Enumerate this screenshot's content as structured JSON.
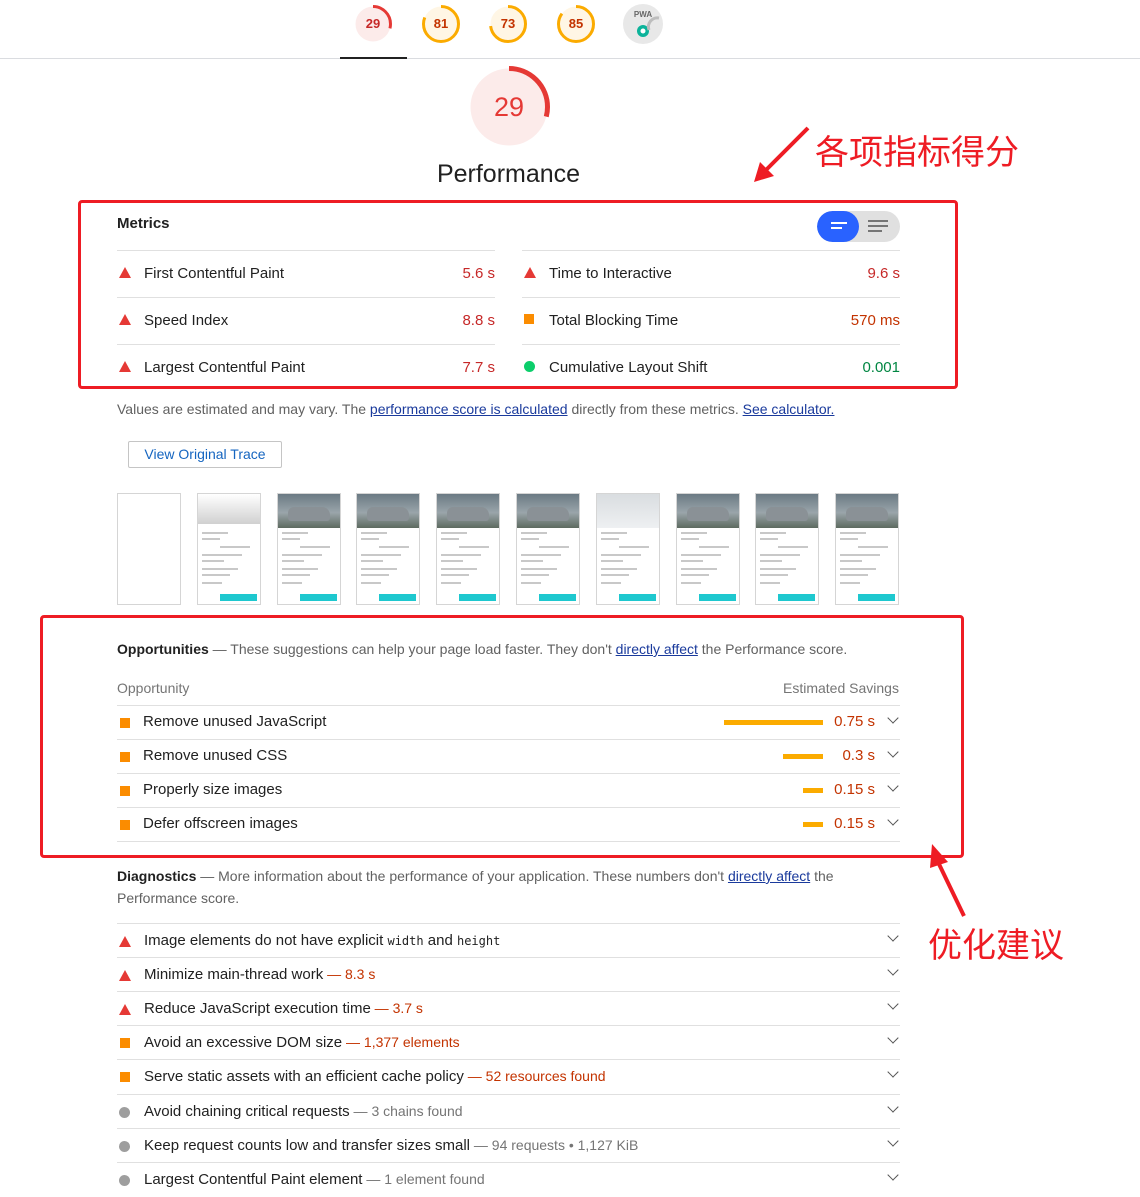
{
  "top_gauges": [
    {
      "label": "29",
      "color": "#e53935",
      "fill": 0.29
    },
    {
      "label": "81",
      "color": "#fbab00",
      "fill": 0.81
    },
    {
      "label": "73",
      "color": "#fbab00",
      "fill": 0.73
    },
    {
      "label": "85",
      "color": "#fbab00",
      "fill": 0.85
    }
  ],
  "pwa_badge": {
    "label": "PWA"
  },
  "performance": {
    "score": "29",
    "score_fraction": 0.29,
    "title": "Performance",
    "color": "#e53935"
  },
  "annotations": {
    "scores_label": "各项指标得分",
    "suggestions_label": "优化建议",
    "color": "#ee1c24"
  },
  "metrics": {
    "heading": "Metrics",
    "left": [
      {
        "label": "First Contentful Paint",
        "value": "5.6 s",
        "status": "fail"
      },
      {
        "label": "Speed Index",
        "value": "8.8 s",
        "status": "fail"
      },
      {
        "label": "Largest Contentful Paint",
        "value": "7.7 s",
        "status": "fail"
      }
    ],
    "right": [
      {
        "label": "Time to Interactive",
        "value": "9.6 s",
        "status": "fail"
      },
      {
        "label": "Total Blocking Time",
        "value": "570 ms",
        "status": "average"
      },
      {
        "label": "Cumulative Layout Shift",
        "value": "0.001",
        "status": "pass"
      }
    ]
  },
  "note": {
    "prefix": "Values are estimated and may vary. The ",
    "link1": "performance score is calculated",
    "middle": " directly from these metrics.",
    "link2": "See calculator."
  },
  "trace_button": "View Original Trace",
  "opportunities": {
    "title": "Opportunities",
    "desc_prefix": " — These suggestions can help your page load faster. They don't ",
    "desc_link": "directly affect",
    "desc_suffix": " the Performance score.",
    "col_left": "Opportunity",
    "col_right": "Estimated Savings",
    "items": [
      {
        "label": "Remove unused JavaScript",
        "value": "0.75 s",
        "savings_fraction": 1.0
      },
      {
        "label": "Remove unused CSS",
        "value": "0.3 s",
        "savings_fraction": 0.4
      },
      {
        "label": "Properly size images",
        "value": "0.15 s",
        "savings_fraction": 0.2
      },
      {
        "label": "Defer offscreen images",
        "value": "0.15 s",
        "savings_fraction": 0.2
      }
    ]
  },
  "diagnostics": {
    "title": "Diagnostics",
    "desc_prefix": " — More information about the performance of your application. These numbers don't ",
    "desc_link": "directly affect",
    "desc_suffix": " the",
    "desc_line2": "Performance score.",
    "items": [
      {
        "label": "Image elements do not have explicit ",
        "code1": "width",
        "and": " and ",
        "code2": "height",
        "status": "fail"
      },
      {
        "label": "Minimize main-thread work",
        "sep": " — ",
        "detail": "8.3 s",
        "status": "fail"
      },
      {
        "label": "Reduce JavaScript execution time",
        "sep": " — ",
        "detail": "3.7 s",
        "status": "fail"
      },
      {
        "label": "Avoid an excessive DOM size",
        "sep": " — ",
        "detail": "1,377 elements",
        "status": "average"
      },
      {
        "label": "Serve static assets with an efficient cache policy",
        "sep": " — ",
        "detail": "52 resources found",
        "status": "average"
      },
      {
        "label": "Avoid chaining critical requests",
        "sep": " — ",
        "detail": "3 chains found",
        "status": "info"
      },
      {
        "label": "Keep request counts low and transfer sizes small",
        "sep": " — ",
        "detail": "94 requests • 1,127 KiB",
        "status": "info"
      },
      {
        "label": "Largest Contentful Paint element",
        "sep": " — ",
        "detail": "1 element found",
        "status": "info"
      }
    ]
  },
  "status_colors": {
    "fail": "#e53935",
    "average": "#fb8c00",
    "pass": "#0cce6b",
    "info": "#9e9e9e"
  }
}
